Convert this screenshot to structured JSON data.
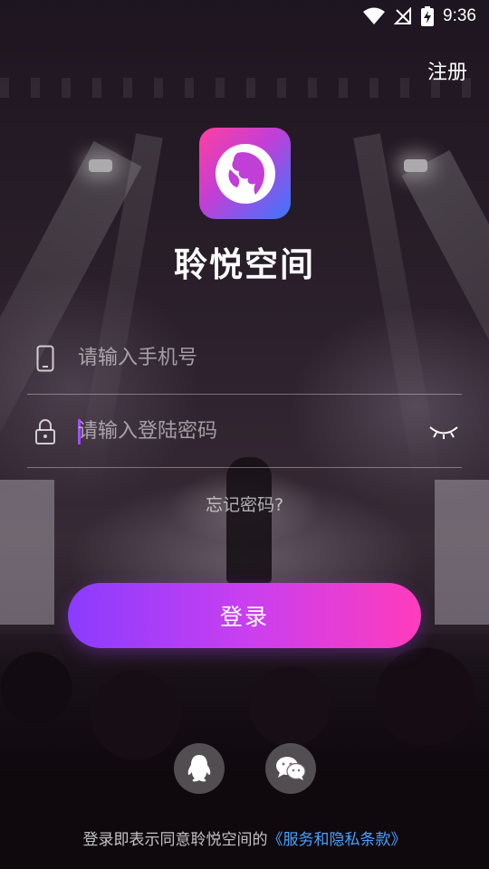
{
  "status_bar": {
    "time": "9:36"
  },
  "header": {
    "register_label": "注册"
  },
  "app": {
    "name": "聆悦空间"
  },
  "form": {
    "phone_placeholder": "请输入手机号",
    "password_placeholder": "请输入登陆密码",
    "forgot_label": "忘记密码?",
    "login_label": "登录"
  },
  "social": {
    "icons": [
      "qq-icon",
      "wechat-icon"
    ]
  },
  "agreement": {
    "prefix": "登录即表示同意聆悦空间的",
    "link": "《服务和隐私条款》"
  },
  "colors": {
    "accent_start": "#8a3cff",
    "accent_end": "#ff3cbc",
    "link": "#4aa0ff"
  }
}
